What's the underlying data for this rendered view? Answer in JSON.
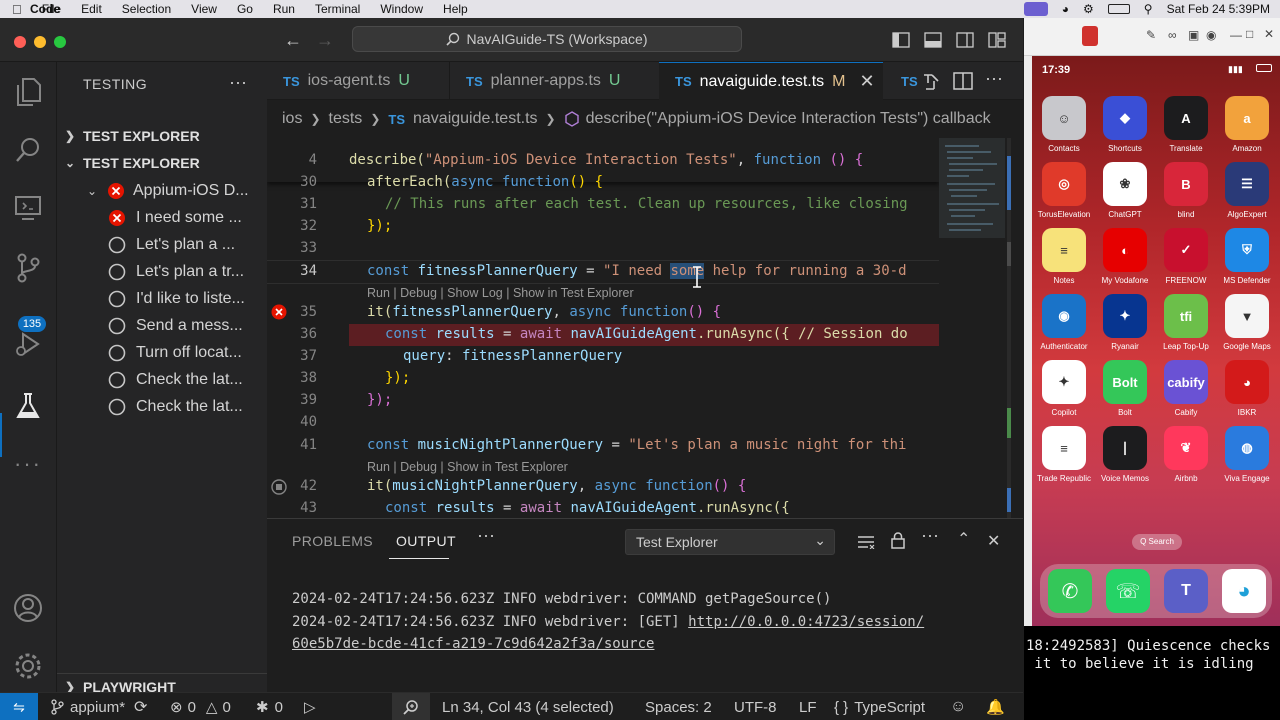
{
  "menubar": {
    "app": "Code",
    "items": [
      "File",
      "Edit",
      "Selection",
      "View",
      "Go",
      "Run",
      "Terminal",
      "Window",
      "Help"
    ],
    "datetime": "Sat Feb 24  5:39PM"
  },
  "titlebar": {
    "search_text": "NavAIGuide-TS (Workspace)"
  },
  "activitybar": {
    "source_control_badge": "135"
  },
  "sidebar": {
    "title": "TESTING",
    "sections": [
      {
        "label": "TEST EXPLORER"
      },
      {
        "label": "TEST EXPLORER"
      },
      {
        "label": "PLAYWRIGHT"
      }
    ],
    "suite": "Appium-iOS D...",
    "tests": [
      {
        "label": "I need some ...",
        "status": "failed"
      },
      {
        "label": "Let's plan a ...",
        "status": "pending"
      },
      {
        "label": "Let's plan a tr...",
        "status": "pending"
      },
      {
        "label": "I'd like to liste...",
        "status": "pending"
      },
      {
        "label": "Send a mess...",
        "status": "pending"
      },
      {
        "label": "Turn off locat...",
        "status": "pending"
      },
      {
        "label": "Check the lat...",
        "status": "pending"
      },
      {
        "label": "Check the lat...",
        "status": "pending"
      }
    ]
  },
  "tabs": [
    {
      "icon": "TS",
      "name": "ios-agent.ts",
      "mark": "U"
    },
    {
      "icon": "TS",
      "name": "planner-apps.ts",
      "mark": "U"
    },
    {
      "icon": "TS",
      "name": "navaiguide.test.ts",
      "mark": "M"
    },
    {
      "icon": "TS",
      "name": ""
    }
  ],
  "breadcrumb": {
    "folder1": "ios",
    "folder2": "tests",
    "file_icon": "TS",
    "file": "navaiguide.test.ts",
    "symbol": "describe(\"Appium-iOS Device Interaction Tests\") callback"
  },
  "editor": {
    "line_numbers": [
      "4",
      "30",
      "31",
      "32",
      "33",
      "34",
      "35",
      "36",
      "37",
      "38",
      "39",
      "40",
      "41",
      "42",
      "43"
    ],
    "codelens": "Run | Debug | Show Log | Show in Test Explorer",
    "codelens2": "Run | Debug | Show in Test Explorer",
    "code": {
      "l4_a": "describe(",
      "l4_b": "\"Appium-iOS Device Interaction Tests\"",
      "l4_c": ", ",
      "l4_d": "function",
      "l4_e": "() {",
      "l30_a": "afterEach(",
      "l30_b": "async",
      "l30_c": "function",
      "l30_d": "() {",
      "l31": "// This runs after each test. Clean up resources, like closing",
      "l32": "});",
      "l34_a": "const",
      "l34_b": "fitnessPlannerQuery",
      "l34_c": " = ",
      "l34_d": "\"I need ",
      "l34_sel": "some",
      "l34_e": " help for running a 30-d",
      "l35_a": "it(",
      "l35_b": "fitnessPlannerQuery",
      "l35_c": ", ",
      "l35_d": "async",
      "l35_e": "function",
      "l35_f": "() {",
      "l36_a": "const",
      "l36_b": "results",
      "l36_c": " = ",
      "l36_d": "await",
      "l36_e": "navAIGuideAgent",
      "l36_f": ".runAsync({ // Session do",
      "l37_a": "query",
      "l37_b": ": ",
      "l37_c": "fitnessPlannerQuery",
      "l38": "});",
      "l39": "});",
      "l41_a": "const",
      "l41_b": "musicNightPlannerQuery",
      "l41_c": " = ",
      "l41_d": "\"Let's plan a music night for thi",
      "l42_a": "it(",
      "l42_b": "musicNightPlannerQuery",
      "l42_c": ", ",
      "l42_d": "async",
      "l42_e": "function",
      "l42_f": "() {",
      "l43_a": "const",
      "l43_b": "results",
      "l43_c": " = ",
      "l43_d": "await",
      "l43_e": "navAIGuideAgent",
      "l43_f": ".runAsync({"
    }
  },
  "panel": {
    "tabs": [
      "PROBLEMS",
      "OUTPUT"
    ],
    "output_channel": "Test Explorer",
    "lines": [
      "2024-02-24T17:24:56.623Z INFO webdriver: COMMAND getPageSource()",
      "2024-02-24T17:24:56.623Z INFO webdriver: [GET] "
    ],
    "link1": "http://0.0.0.0:4723/session/",
    "link2": "60e5b7de-bcde-41cf-a219-7c9d642a2f3a/source"
  },
  "statusbar": {
    "branch": "appium*",
    "errors": "0",
    "warnings": "0",
    "ports": "0",
    "cursor": "Ln 34, Col 43 (4 selected)",
    "spaces": "Spaces: 2",
    "encoding": "UTF-8",
    "eol": "LF",
    "language": "TypeScript"
  },
  "iphone": {
    "time": "17:39",
    "apps": [
      {
        "label": "Contacts",
        "color": "#c8c8cc",
        "glyph": "☺"
      },
      {
        "label": "Shortcuts",
        "color": "#3a4fd6",
        "glyph": "◆"
      },
      {
        "label": "Translate",
        "color": "#1c1c1e",
        "glyph": "A"
      },
      {
        "label": "Amazon",
        "color": "#f2a23c",
        "glyph": "a"
      },
      {
        "label": "TorusElevation",
        "color": "#e03a2a",
        "glyph": "◎"
      },
      {
        "label": "ChatGPT",
        "color": "#ffffff",
        "glyph": "❀"
      },
      {
        "label": "blind",
        "color": "#d8263a",
        "glyph": "B"
      },
      {
        "label": "AlgoExpert",
        "color": "#2a3a78",
        "glyph": "☰"
      },
      {
        "label": "Notes",
        "color": "#f7e27a",
        "glyph": "≡"
      },
      {
        "label": "My Vodafone",
        "color": "#e60000",
        "glyph": "◐"
      },
      {
        "label": "FREENOW",
        "color": "#c8102e",
        "glyph": "✓"
      },
      {
        "label": "MS Defender",
        "color": "#1e88e5",
        "glyph": "⛨"
      },
      {
        "label": "Authenticator",
        "color": "#1a73c8",
        "glyph": "◉"
      },
      {
        "label": "Ryanair",
        "color": "#073590",
        "glyph": "✦"
      },
      {
        "label": "Leap Top-Up",
        "color": "#6cbf4a",
        "glyph": "tfi"
      },
      {
        "label": "Google Maps",
        "color": "#f5f5f5",
        "glyph": "▼"
      },
      {
        "label": "Copilot",
        "color": "#ffffff",
        "glyph": "✦"
      },
      {
        "label": "Bolt",
        "color": "#34c759",
        "glyph": "Bolt"
      },
      {
        "label": "Cabify",
        "color": "#6a52d4",
        "glyph": "cabify"
      },
      {
        "label": "IBKR",
        "color": "#d31a1a",
        "glyph": "◕"
      },
      {
        "label": "Trade Republic",
        "color": "#ffffff",
        "glyph": "≡"
      },
      {
        "label": "Voice Memos",
        "color": "#1c1c1e",
        "glyph": "∣"
      },
      {
        "label": "Airbnb",
        "color": "#ff385c",
        "glyph": "❦"
      },
      {
        "label": "Viva Engage",
        "color": "#2a7bde",
        "glyph": "◍"
      }
    ],
    "search": "Q Search"
  },
  "terminal": {
    "line1": "18:2492583] Quiescence checks",
    "line2": " it to believe it is idling"
  },
  "colors": {
    "accent": "#0e70c0",
    "error": "#e51400",
    "editor_bg": "#1e1e1e"
  }
}
